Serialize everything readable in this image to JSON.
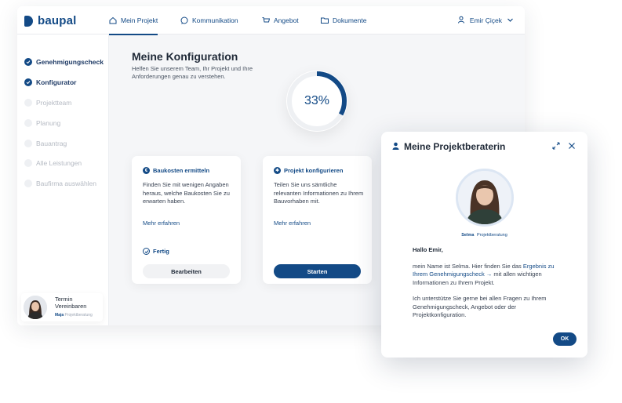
{
  "app": {
    "brand": "baupal",
    "nav": [
      {
        "label": "Mein Projekt",
        "icon": "home-icon",
        "active": true
      },
      {
        "label": "Kommunikation",
        "icon": "chat-bubble-icon",
        "active": false
      },
      {
        "label": "Angebot",
        "icon": "cart-icon",
        "active": false
      },
      {
        "label": "Dokumente",
        "icon": "folder-icon",
        "active": false
      }
    ],
    "user": {
      "name": "Emir Çiçek",
      "icon": "user-icon"
    }
  },
  "sidebar": {
    "items": [
      {
        "label": "Genehmigungscheck",
        "state": "done"
      },
      {
        "label": "Konfigurator",
        "state": "current"
      },
      {
        "label": "Projektteam",
        "state": "pending"
      },
      {
        "label": "Planung",
        "state": "pending"
      },
      {
        "label": "Bauantrag",
        "state": "pending"
      },
      {
        "label": "Alle Leistungen",
        "state": "pending"
      },
      {
        "label": "Baufirma auswählen",
        "state": "pending"
      }
    ],
    "advisor_card": {
      "label": "Termin Vereinbaren",
      "name": "Maja",
      "role": "Projektberatung"
    }
  },
  "main": {
    "title": "Meine Konfiguration",
    "subtitle": "Helfen Sie unserem Team, Ihr Projekt und Ihre Anforderungen genau zu verstehen.",
    "progress": {
      "label": "33%",
      "value": 0.33
    },
    "cards": [
      {
        "title": "Baukosten ermitteln",
        "icon": "euro-icon",
        "body": "Finden Sie mit wenigen Angaben heraus, welche Baukosten Sie zu erwarten haben.",
        "link": "Mehr erfahren",
        "status": "Fertig",
        "button": "Bearbeiten"
      },
      {
        "title": "Projekt konfigurieren",
        "icon": "gear-icon",
        "body": "Teilen Sie uns sämtliche relevanten Informationen zu Ihrem Bauvorhaben mit.",
        "link": "Mehr erfahren",
        "button": "Starten"
      }
    ]
  },
  "popup": {
    "title": "Meine Projektberaterin",
    "advisor_name": "Selma",
    "advisor_role": "Projektberatung",
    "greeting": "Hallo Emir,",
    "intro": "mein Name ist Selma. Hier finden Sie das",
    "link": "Ergebnis zu Ihrem Genehmigungscheck →",
    "after_link": " mit allen wichtigen Informationen zu Ihrem Projekt.",
    "paragraph2": "Ich unterstütze Sie gerne bei allen Fragen zu Ihrem Genehmigungscheck, Angebot oder der Projektkonfiguration.",
    "ok": "OK"
  },
  "colors": {
    "accent": "#134a86",
    "background": "#f5f6f8",
    "muted": "#b5bac3"
  }
}
